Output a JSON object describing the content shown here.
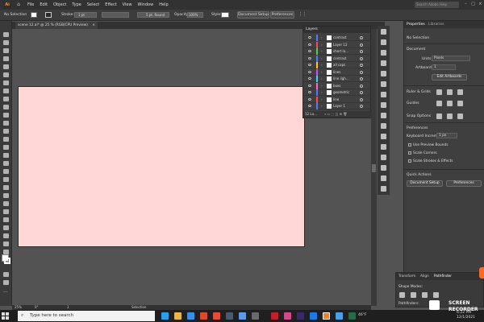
{
  "app": {
    "logo_text": "Ai",
    "menu": [
      "File",
      "Edit",
      "Object",
      "Type",
      "Select",
      "Effect",
      "View",
      "Window",
      "Help"
    ],
    "search_placeholder": "Search Adobe Help"
  },
  "control_bar": {
    "selection_label": "No Selection",
    "stroke_label": "Stroke:",
    "stroke_value": "1 pt",
    "brush_label": "5 pt. Round",
    "opacity_label": "Opacity:",
    "opacity_value": "100%",
    "style_label": "Style:",
    "document_setup": "Document Setup",
    "preferences": "Preferences"
  },
  "document_tab": {
    "title": "scene 12.ai* @ 25 % (RGB/CPU Preview)",
    "close": "×"
  },
  "layers_panel": {
    "title": "Layers",
    "rows": [
      {
        "name": "contrast",
        "color": "#4a7cff"
      },
      {
        "name": "Layer 12",
        "color": "#ff4a4a"
      },
      {
        "name": "short la...",
        "color": "#4ad34a"
      },
      {
        "name": "contrast",
        "color": "#4a7cff"
      },
      {
        "name": "all caps",
        "color": "#ffcc00"
      },
      {
        "name": "lines",
        "color": "#c94aff"
      },
      {
        "name": "line ligh...",
        "color": "#44ccff"
      },
      {
        "name": "boxs",
        "color": "#ff66cc"
      },
      {
        "name": "geometric",
        "color": "#4a7cff"
      },
      {
        "name": "line",
        "color": "#ff4a4a"
      },
      {
        "name": "Layer 1",
        "color": "#4a7cff"
      }
    ],
    "footer": "12 La..."
  },
  "properties_panel": {
    "tabs": [
      "Properties",
      "Libraries"
    ],
    "no_selection": "No Selection",
    "document_label": "Document",
    "units_label": "Units:",
    "units_value": "Pixels",
    "artboard_label": "Artboard:",
    "artboard_value": "1",
    "edit_artboards": "Edit Artboards",
    "ruler_grids": "Ruler & Grids",
    "guides": "Guides",
    "snap_options": "Snap Options",
    "preferences_label": "Preferences",
    "keyboard_increment_label": "Keyboard Increment:",
    "keyboard_increment_value": "1 px",
    "checkboxes": [
      "Use Preview Bounds",
      "Scale Corners",
      "Scale Strokes & Effects"
    ],
    "quick_actions": "Quick Actions",
    "document_setup": "Document Setup",
    "preferences": "Preferences"
  },
  "pathfinder_panel": {
    "tabs": [
      "Transform",
      "Align",
      "Pathfinder"
    ],
    "shape_modes": "Shape Modes:",
    "pathfinders": "Pathfinders:"
  },
  "status_bar": {
    "zoom": "25%",
    "rotation": "0°",
    "page": "1",
    "tool": "Selection"
  },
  "taskbar": {
    "search_placeholder": "Type here to search",
    "weather": "46°F",
    "time": "6:22 PM",
    "date": "12/1/2021"
  },
  "watermark": {
    "line1": "SCREEN",
    "line2": "RECORDER"
  }
}
